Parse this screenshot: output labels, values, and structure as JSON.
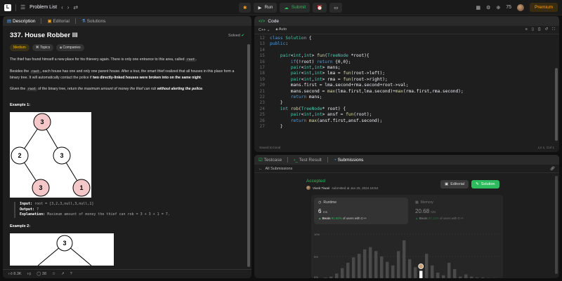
{
  "topbar": {
    "logo_letter": "L",
    "problem_list": "Problem List",
    "run": "Run",
    "submit": "Submit",
    "streak": "75",
    "premium": "Premium"
  },
  "left": {
    "tabs": [
      "Description",
      "Editorial",
      "Solutions"
    ],
    "title": "337. House Robber III",
    "solved": "Solved",
    "difficulty": "Medium",
    "topics": "Topics",
    "companies": "Companies",
    "p1_a": "The thief has found himself a new place for his thievery again. There is only one entrance to this area, called ",
    "p1_code": "root",
    "p1_b": ".",
    "p2_a": "Besides the ",
    "p2_code": "root",
    "p2_b": ", each house has one and only one parent house. After a tour, the smart thief realized that all houses in this place form a binary tree. It will automatically contact the police if ",
    "p2_bold": "two directly-linked houses were broken into on the same night",
    "p2_c": ".",
    "p3_a": "Given the ",
    "p3_code": "root",
    "p3_b": " of the binary tree, return ",
    "p3_italic": "the maximum amount of money the thief can rob ",
    "p3_bold": "without alerting the police",
    "p3_c": ".",
    "example1": "Example 1:",
    "example2": "Example 2:",
    "ex1_input_label": "Input:",
    "ex1_input": "root = [3,2,3,null,3,null,1]",
    "ex1_output_label": "Output:",
    "ex1_output": "7",
    "ex1_expl_label": "Explanation:",
    "ex1_expl": "Maximum amount of money the thief can rob = 3 + 3 + 1 = 7.",
    "tree1": [
      "3",
      "2",
      "3",
      "3",
      "1"
    ],
    "tree2_root": "3",
    "likes": "8.3K",
    "comments": "38"
  },
  "code": {
    "tab": "Code",
    "lang": "C++",
    "auto": "Auto",
    "saved": "Saved to local",
    "position": "Ln 1, Col 1",
    "lines": [
      {
        "n": "12",
        "t": "class Solution {"
      },
      {
        "n": "13",
        "t": "public:"
      },
      {
        "n": "14",
        "t": ""
      },
      {
        "n": "15",
        "t": "    pair<int,int> fun(TreeNode *root){"
      },
      {
        "n": "16",
        "t": "        if(!root) return {0,0};"
      },
      {
        "n": "17",
        "t": "        pair<int,int> mans;"
      },
      {
        "n": "18",
        "t": "        pair<int,int> lma = fun(root->left);"
      },
      {
        "n": "19",
        "t": "        pair<int,int> rma = fun(root->right);"
      },
      {
        "n": "20",
        "t": "        mans.first = lma.second+rma.second+root->val;"
      },
      {
        "n": "21",
        "t": "        mans.second = max(lma.first,lma.second)+max(rma.first,rma.second);"
      },
      {
        "n": "22",
        "t": "        return mans;"
      },
      {
        "n": "23",
        "t": "    }"
      },
      {
        "n": "24",
        "t": "    int rob(TreeNode* root) {"
      },
      {
        "n": "25",
        "t": "        pair<int,int> ansf = fun(root);"
      },
      {
        "n": "26",
        "t": "        return max(ansf.first,ansf.second);"
      },
      {
        "n": "27",
        "t": "    }"
      }
    ]
  },
  "result": {
    "tabs": [
      "Testcase",
      "Test Result",
      "Submissions"
    ],
    "all_submissions": "All Submissions",
    "status": "Accepted",
    "user": "Vivek Tiwari",
    "submitted": "submitted at Jan 25, 2024 18:54",
    "editorial": "Editorial",
    "solution": "Solution",
    "runtime_label": "Runtime",
    "runtime_value": "6",
    "runtime_unit": "ms",
    "beats_word": "Beats",
    "runtime_beats": "91.60%",
    "beats_suffix": "of users with C++",
    "memory_label": "Memory",
    "memory_value": "20.68",
    "memory_unit": "MB",
    "memory_beats": "97.14%",
    "tick_10": "10%",
    "tick_5": "5%",
    "tick_0": "0%"
  },
  "chart_data": {
    "type": "bar",
    "values": [
      0.3,
      0.5,
      1.2,
      2.4,
      3.6,
      4.8,
      5.6,
      6.6,
      7.1,
      6.2,
      5.0,
      3.8,
      3.0,
      6.2,
      8.6,
      4.4,
      2.6,
      1.8,
      5.6,
      3.0,
      1.4,
      0.8,
      3.6,
      2.2,
      0.5,
      1.0,
      0.5,
      0.3,
      0.3,
      0.2,
      0.2
    ],
    "highlight_index": 17,
    "ylim": [
      0,
      10
    ]
  },
  "colors": {
    "accent": "#ffa116",
    "green": "#2cbb5d",
    "blue": "#4aa3ff"
  }
}
